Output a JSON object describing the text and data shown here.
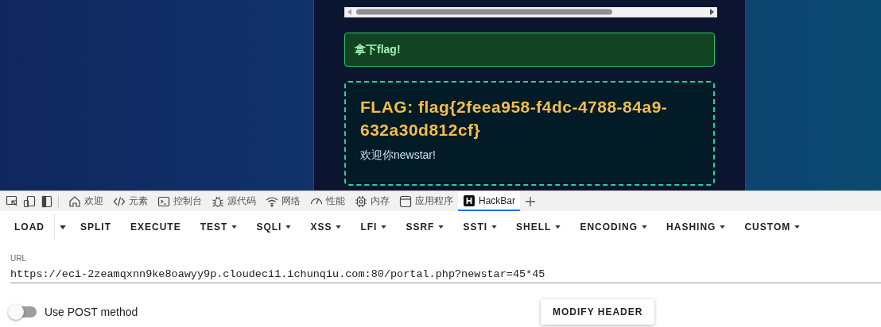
{
  "page": {
    "success_message": "拿下flag!",
    "flag_text": "FLAG: flag{2feea958-f4dc-4788-84a9-632a30d812cf}",
    "welcome": "欢迎你newstar!"
  },
  "devtools": {
    "tabs": [
      {
        "label": "欢迎",
        "selected": false
      },
      {
        "label": "元素",
        "selected": false
      },
      {
        "label": "控制台",
        "selected": false
      },
      {
        "label": "源代码",
        "selected": false
      },
      {
        "label": "网络",
        "selected": false
      },
      {
        "label": "性能",
        "selected": false
      },
      {
        "label": "内存",
        "selected": false
      },
      {
        "label": "应用程序",
        "selected": false
      },
      {
        "label": "HackBar",
        "selected": true
      }
    ]
  },
  "hackbar": {
    "toolbar": [
      {
        "label": "LOAD",
        "kind": "split"
      },
      {
        "label": "SPLIT",
        "kind": "plain"
      },
      {
        "label": "EXECUTE",
        "kind": "plain"
      },
      {
        "label": "TEST",
        "kind": "menu"
      },
      {
        "label": "SQLI",
        "kind": "menu"
      },
      {
        "label": "XSS",
        "kind": "menu"
      },
      {
        "label": "LFI",
        "kind": "menu"
      },
      {
        "label": "SSRF",
        "kind": "menu"
      },
      {
        "label": "SSTI",
        "kind": "menu"
      },
      {
        "label": "SHELL",
        "kind": "menu"
      },
      {
        "label": "ENCODING",
        "kind": "menu"
      },
      {
        "label": "HASHING",
        "kind": "menu"
      },
      {
        "label": "CUSTOM",
        "kind": "menu"
      }
    ],
    "url": {
      "label": "URL",
      "value": "https://eci-2zeamqxnn9ke8oawyy9p.cloudeci1.ichunqiu.com:80/portal.php?newstar=45*45"
    },
    "post_method": {
      "label": "Use POST method",
      "on": false
    },
    "modify_header": "MODIFY HEADER"
  }
}
